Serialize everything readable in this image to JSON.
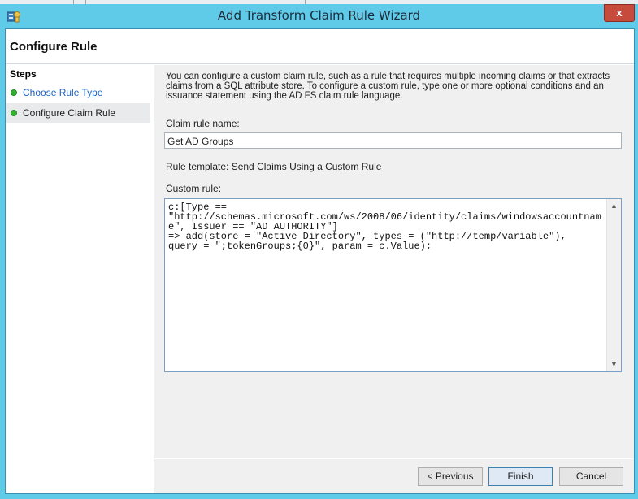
{
  "window": {
    "title": "Add Transform Claim Rule Wizard",
    "close_label": "x"
  },
  "header": {
    "page_title": "Configure Rule"
  },
  "steps": {
    "title": "Steps",
    "items": [
      {
        "label": "Choose Rule Type",
        "state": "completed-link"
      },
      {
        "label": "Configure Claim Rule",
        "state": "current"
      }
    ]
  },
  "content": {
    "description": "You can configure a custom claim rule, such as a rule that requires multiple incoming claims or that extracts claims from a SQL attribute store. To configure a custom rule, type one or more optional conditions and an issuance statement using the AD FS claim rule language.",
    "claim_rule_name_label": "Claim rule name:",
    "claim_rule_name_value": "Get AD Groups",
    "rule_template": "Rule template: Send Claims Using a Custom Rule",
    "custom_rule_label": "Custom rule:",
    "custom_rule_value": "c:[Type ==\n\"http://schemas.microsoft.com/ws/2008/06/identity/claims/windowsaccountname\", Issuer == \"AD AUTHORITY\"]\n=> add(store = \"Active Directory\", types = (\"http://temp/variable\"),\nquery = \";tokenGroups;{0}\", param = c.Value);"
  },
  "buttons": {
    "previous": "< Previous",
    "finish": "Finish",
    "cancel": "Cancel"
  },
  "colors": {
    "title_bar": "#5fcbe9",
    "close_button": "#c64b3c",
    "step_dot": "#34b233",
    "link": "#1a63c6"
  }
}
